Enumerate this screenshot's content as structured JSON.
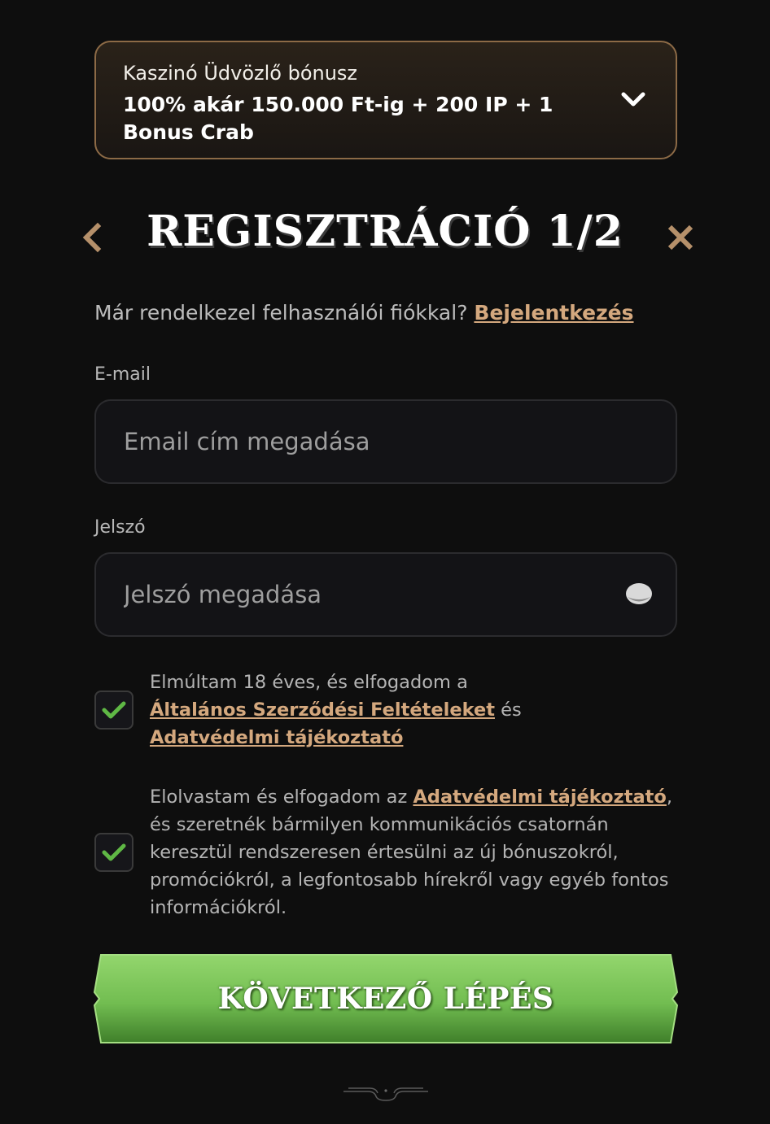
{
  "bonus": {
    "label": "Kaszinó Üdvözlő bónusz",
    "text": "100% akár 150.000 Ft-ig + 200 IP + 1 Bonus Crab",
    "expand_icon": "chevron-down-icon"
  },
  "header": {
    "title": "REGISZTRÁCIÓ 1/2",
    "back_icon": "chevron-left-icon",
    "close_icon": "close-icon"
  },
  "login": {
    "prompt": "Már rendelkezel felhasználói fiókkal? ",
    "link": "Bejelentkezés"
  },
  "email": {
    "label": "E-mail",
    "placeholder": "Email cím megadása",
    "value": ""
  },
  "password": {
    "label": "Jelszó",
    "placeholder": "Jelszó megadása",
    "value": "",
    "toggle_icon": "eye-icon"
  },
  "consent_terms": {
    "checked": true,
    "text_before": "Elmúltam 18 éves, és elfogadom a",
    "terms_link": "Általános Szerződési Feltételeket",
    "and": " és",
    "privacy_link": "Adatvédelmi tájékoztató"
  },
  "consent_marketing": {
    "checked": true,
    "text_before": "Elolvastam és elfogadom az ",
    "privacy_link": "Adatvédelmi tájékoztató",
    "text_after": ", és szeretnék bármilyen kommunikációs csatornán keresztül rendszeresen értesülni az új bónuszokról, promóciókról, a legfontosabb hírekről vagy egyéb fontos információkról."
  },
  "next_button": {
    "label": "KÖVETKEZŐ LÉPÉS"
  },
  "colors": {
    "background": "#0e0e0e",
    "accent_link": "#d4a87e",
    "bonus_border": "#8c6a46",
    "button_green_top": "#93d66d",
    "button_green_bottom": "#3f7f2a",
    "check_green": "#5fb845"
  }
}
